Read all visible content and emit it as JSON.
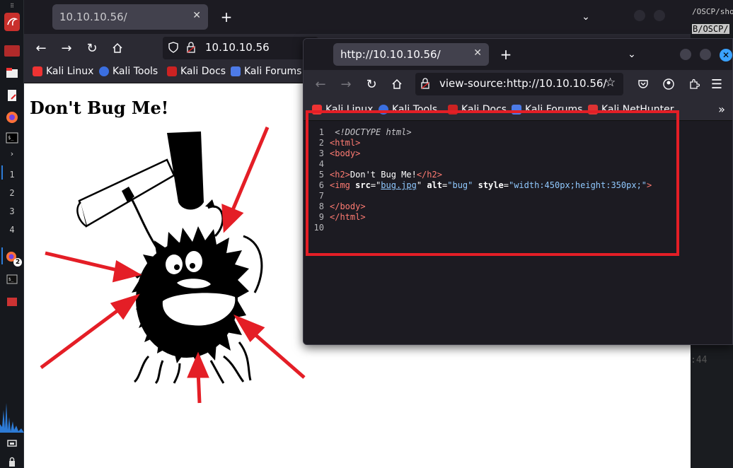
{
  "taskbar": {
    "workspaces": [
      "1",
      "2",
      "3",
      "4"
    ],
    "firefox_badge": "2"
  },
  "background_terminal": {
    "lines": [
      "/OSCP/sho",
      "B/OSCP/"
    ],
    "time_fragment": ":44"
  },
  "main_browser": {
    "tab_title": "10.10.10.56/",
    "url": "10.10.10.56",
    "bookmarks": [
      "Kali Linux",
      "Kali Tools",
      "Kali Docs",
      "Kali Forums"
    ],
    "page_heading": "Don't Bug Me!"
  },
  "source_window": {
    "tab_title": "http://10.10.10.56/",
    "url": "view-source:http://10.10.10.56/",
    "bookmarks": [
      "Kali Linux",
      "Kali Tools",
      "Kali Docs",
      "Kali Forums",
      "Kali NetHunter"
    ],
    "line_numbers": [
      "1",
      "2",
      "3",
      "4",
      "5",
      "6",
      "7",
      "8",
      "9",
      "10"
    ],
    "code": {
      "l1": "<!DOCTYPE html>",
      "html_open": "<html>",
      "body_open": "<body>",
      "h2_open": "<h2>",
      "h2_text": "Don't Bug Me!",
      "h2_close": "</h2>",
      "img_tag": "<img",
      "src_attr": "src",
      "src_val": "bug.jpg",
      "alt_attr": "alt",
      "alt_val": "\"bug\"",
      "style_attr": "style",
      "style_val": "\"width:450px;height:350px;\"",
      "img_end": ">",
      "body_close": "</body>",
      "html_close": "</html>"
    }
  },
  "colors": {
    "highlight_box": "#e41e26",
    "arrow": "#e41e26",
    "tag": "#ff7b72",
    "value": "#90c9ff"
  }
}
